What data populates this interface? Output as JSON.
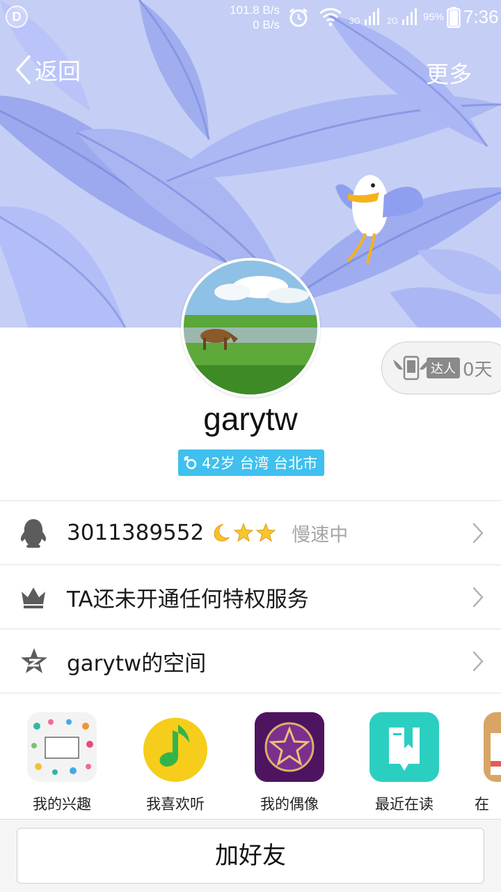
{
  "statusbar": {
    "net_down": "101.8 B/s",
    "net_up": "0 B/s",
    "sig3g": "3G",
    "sig2g": "2G",
    "battery_pct": "95%",
    "time": "7:36"
  },
  "nav": {
    "back_label": "返回",
    "more_label": "更多"
  },
  "profile": {
    "nickname": "garytw",
    "info": "42岁 台湾 台北市",
    "gender_icon": "male-icon",
    "daren_tag": "达人",
    "daren_days": "0天"
  },
  "rows": [
    {
      "icon": "qq-penguin-icon",
      "text": "3011389552",
      "status": "慢速中"
    },
    {
      "icon": "crown-icon",
      "text": "TA还未开通任何特权服务"
    },
    {
      "icon": "qzone-star-icon",
      "text": "garytw的空间"
    }
  ],
  "apps": [
    {
      "name": "我的兴趣"
    },
    {
      "name": "我喜欢听"
    },
    {
      "name": "我的偶像"
    },
    {
      "name": "最近在读"
    },
    {
      "name": "在"
    }
  ],
  "actions": {
    "add_friend": "加好友"
  },
  "colors": {
    "banner": "#c3ccf4",
    "tag": "#3fc0ee",
    "divider": "#e2e2e2"
  }
}
